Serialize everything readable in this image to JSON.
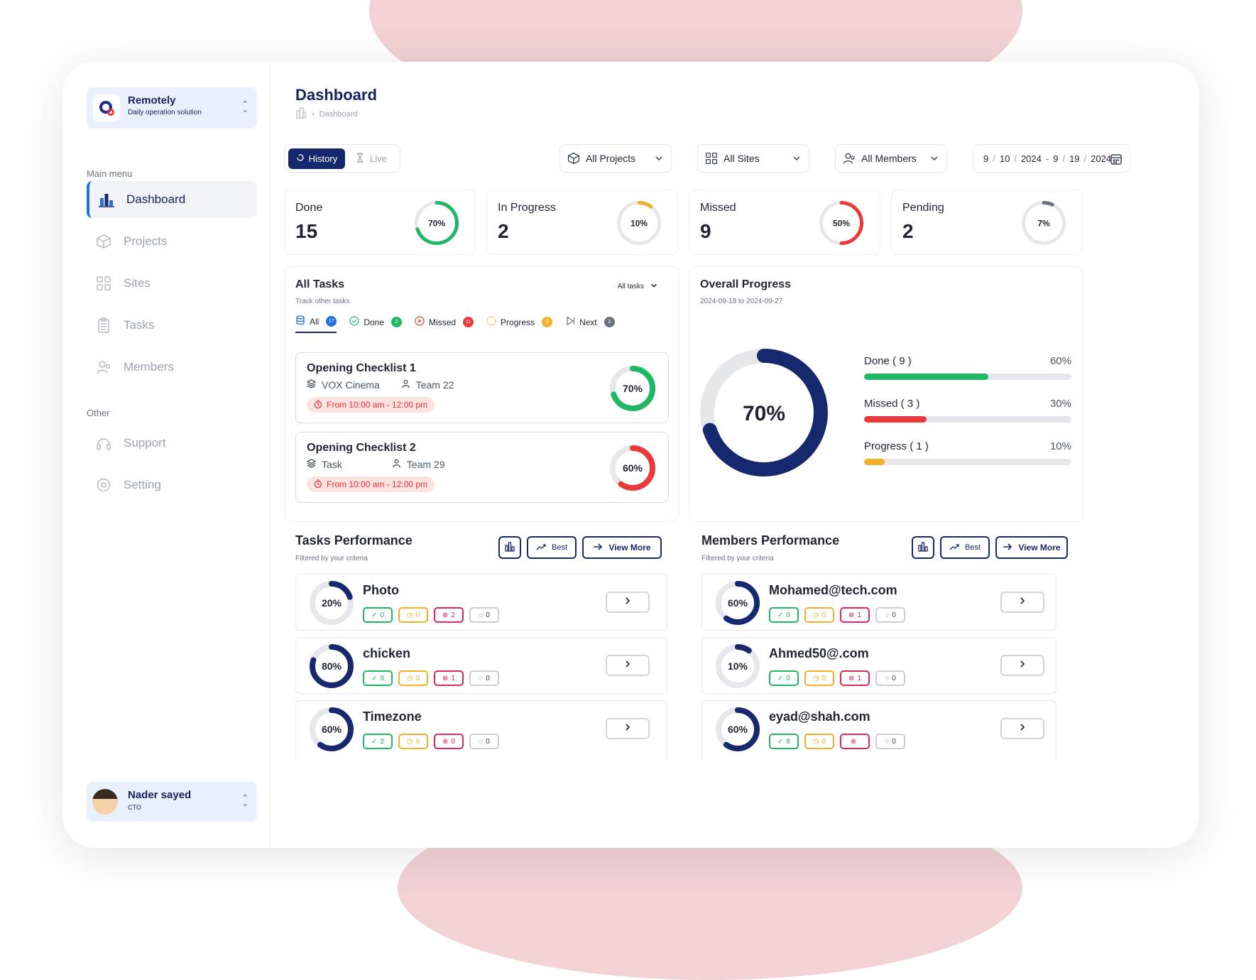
{
  "app": {
    "name": "Remotely",
    "tagline": "Daily operation solution"
  },
  "sidebar": {
    "main_menu_label": "Main menu",
    "main_items": [
      {
        "label": "Dashboard",
        "icon": "bar-chart-icon",
        "active": true
      },
      {
        "label": "Projects",
        "icon": "cube-icon",
        "active": false
      },
      {
        "label": "Sites",
        "icon": "grid-icon",
        "active": false
      },
      {
        "label": "Tasks",
        "icon": "clipboard-icon",
        "active": false
      },
      {
        "label": "Members",
        "icon": "users-icon",
        "active": false
      }
    ],
    "other_label": "Other",
    "other_items": [
      {
        "label": "Support",
        "icon": "headset-icon"
      },
      {
        "label": "Setting",
        "icon": "gear-icon"
      }
    ],
    "user": {
      "name": "Nader sayed",
      "role": "CTO"
    }
  },
  "header": {
    "title": "Dashboard",
    "breadcrumb": "Dashboard"
  },
  "toolbar": {
    "history_label": "History",
    "live_label": "Live",
    "projects_label": "All Projects",
    "sites_label": "All Sites",
    "members_label": "All Members",
    "date_from": {
      "m": "9",
      "d": "10",
      "y": "2024"
    },
    "date_to": {
      "m": "9",
      "d": "19",
      "y": "2024"
    }
  },
  "stats": [
    {
      "label": "Done",
      "value": "15",
      "percent": 70,
      "pct_label": "70%",
      "color": "#1eb866"
    },
    {
      "label": "In Progress",
      "value": "2",
      "percent": 10,
      "pct_label": "10%",
      "color": "#f2b02a"
    },
    {
      "label": "Missed",
      "value": "9",
      "percent": 50,
      "pct_label": "50%",
      "color": "#e83a3a"
    },
    {
      "label": "Pending",
      "value": "2",
      "percent": 7,
      "pct_label": "7%",
      "color": "#6b7280"
    }
  ],
  "all_tasks": {
    "title": "All Tasks",
    "subtitle": "Track other tasks",
    "dropdown": "All tasks",
    "tabs": [
      {
        "label": "All",
        "count": "17",
        "color": "#1f6fe5"
      },
      {
        "label": "Done",
        "count": "2",
        "color": "#1eb866"
      },
      {
        "label": "Missed",
        "count": "11",
        "color": "#e83a3a"
      },
      {
        "label": "Progress",
        "count": "2",
        "color": "#f2b02a"
      },
      {
        "label": "Next",
        "count": "2",
        "color": "#6b7280"
      }
    ],
    "items": [
      {
        "title": "Opening Checklist 1",
        "location": "VOX Cinema",
        "team": "Team 22",
        "time": "From 10:00 am - 12:00 pm",
        "percent": 70,
        "pct_label": "70%",
        "color": "#1eb866"
      },
      {
        "title": "Opening Checklist 2",
        "location": "Task",
        "team": "Team 29",
        "time": "From 10:00 am - 12:00 pm",
        "percent": 60,
        "pct_label": "60%",
        "color": "#e83a3a"
      }
    ]
  },
  "overall_progress": {
    "title": "Overall Progress",
    "range": "2024-09-18 to 2024-09-27",
    "percent": 70,
    "center_label": "70%",
    "legend": [
      {
        "label": "Done ( 9 )",
        "pct_label": "60%",
        "percent": 60,
        "color": "#1eb866"
      },
      {
        "label": "Missed ( 3 )",
        "pct_label": "30%",
        "percent": 30,
        "color": "#e83a3a"
      },
      {
        "label": "Progress ( 1 )",
        "pct_label": "10%",
        "percent": 10,
        "color": "#f2b02a"
      }
    ]
  },
  "tasks_performance": {
    "title": "Tasks Performance",
    "subtitle": "Filtered by your criteria",
    "best_label": "Best",
    "view_more_label": "View More",
    "rows": [
      {
        "name": "Photo",
        "percent": 20,
        "pct_label": "20%",
        "done": "0",
        "progress": "0",
        "missed": "2",
        "next": "0"
      },
      {
        "name": "chicken",
        "percent": 80,
        "pct_label": "80%",
        "done": "9",
        "progress": "0",
        "missed": "1",
        "next": "0"
      },
      {
        "name": "Timezone",
        "percent": 60,
        "pct_label": "60%",
        "done": "2",
        "progress": "6",
        "missed": "0",
        "next": "0"
      }
    ]
  },
  "members_performance": {
    "title": "Members Performance",
    "subtitle": "Filtered by your criteria",
    "best_label": "Best",
    "view_more_label": "View More",
    "rows": [
      {
        "name": "Mohamed@tech.com",
        "percent": 60,
        "pct_label": "60%",
        "done": "0",
        "progress": "0",
        "missed": "1",
        "next": "0"
      },
      {
        "name": "Ahmed50@.com",
        "percent": 10,
        "pct_label": "10%",
        "done": "0",
        "progress": "0",
        "missed": "1",
        "next": "0"
      },
      {
        "name": "eyad@shah.com",
        "percent": 60,
        "pct_label": "60%",
        "done": "8",
        "progress": "0",
        "missed": "",
        "next": "0"
      }
    ]
  },
  "colors": {
    "primary": "#16286e",
    "accent": "#1f6fe5",
    "done": "#1eb866",
    "progress": "#f2b02a",
    "missed": "#e83a3a",
    "blob": "#f2d2d3"
  }
}
